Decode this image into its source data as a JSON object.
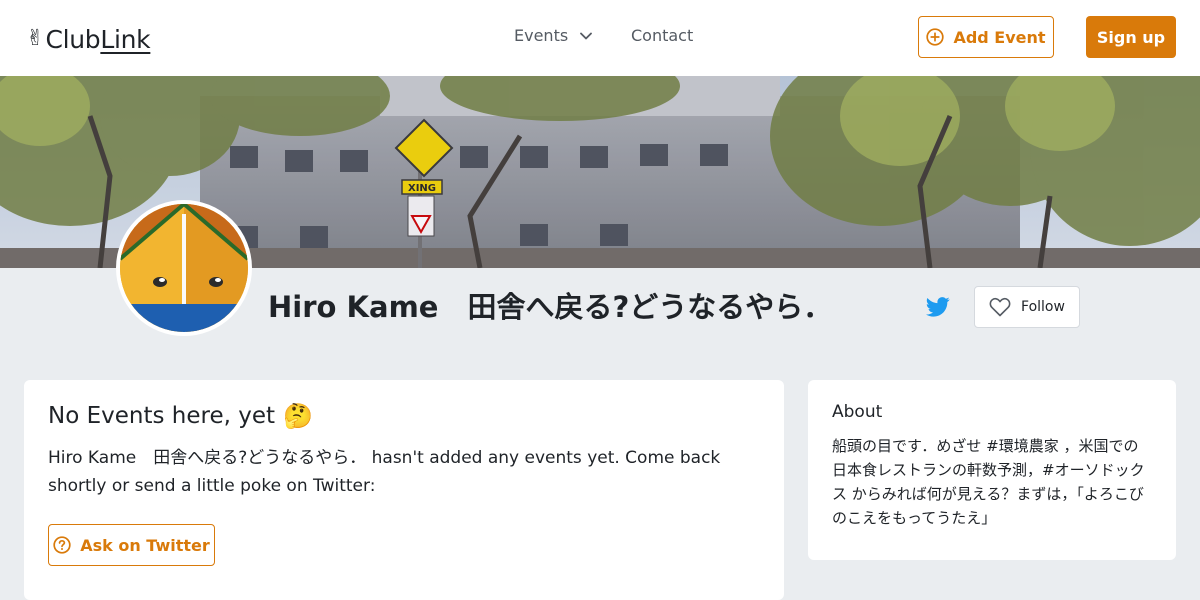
{
  "header": {
    "logo_club": "Club",
    "logo_link": "Link",
    "nav_events": "Events",
    "nav_contact": "Contact",
    "add_event": "Add Event",
    "sign_up": "Sign up"
  },
  "profile": {
    "name": "Hiro Kame　田舎へ戻る?どうなるやら．",
    "follow": "Follow"
  },
  "events_card": {
    "title": "No Events here, yet",
    "title_emoji": "🤔",
    "message": "Hiro Kame　田舎へ戻る?どうなるやら． hasn't added any events yet. Come back shortly or send a little poke on Twitter:",
    "ask_button": "Ask on Twitter"
  },
  "about_card": {
    "title": "About",
    "text": "船頭の目です．めざせ #環境農家 ，米国での日本食レストランの軒数予測，#オーソドックス からみれば何が見える？まずは，「よろこびのこえをもってうたえ」"
  },
  "colors": {
    "accent": "#d97a0a",
    "background": "#eaedf0",
    "twitter": "#1d9bf0"
  }
}
